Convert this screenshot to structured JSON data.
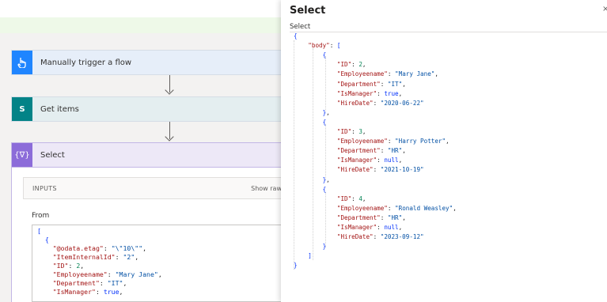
{
  "flow": {
    "steps": [
      {
        "label": "Manually trigger a flow",
        "icon": "hand-pointer-icon"
      },
      {
        "label": "Get items",
        "icon": "sharepoint-icon",
        "icon_text": "S"
      },
      {
        "label": "Select",
        "icon": "data-operation-icon",
        "icon_text": "{∇}"
      }
    ],
    "inputs_title": "INPUTS",
    "show_raw": "Show raw",
    "from_label": "From",
    "code_lines": [
      "[",
      "  {",
      "    \"@odata.etag\": \"\\\"10\\\"\",",
      "    \"ItemInternalId\": \"2\",",
      "    \"ID\": 2,",
      "    \"Employeename\": \"Mary Jane\",",
      "    \"Department\": \"IT\",",
      "    \"IsManager\": true,"
    ]
  },
  "panel": {
    "title": "Select",
    "subtitle": "Select",
    "json_lines": [
      "{",
      "  \"body\": [",
      "    {",
      "      \"ID\": 2,",
      "      \"Employeename\": \"Mary Jane\",",
      "      \"Department\": \"IT\",",
      "      \"IsManager\": true,",
      "      \"HireDate\": \"2020-06-22\"",
      "    },",
      "    {",
      "      \"ID\": 3,",
      "      \"Employeename\": \"Harry Potter\",",
      "      \"Department\": \"HR\",",
      "      \"IsManager\": null,",
      "      \"HireDate\": \"2021-10-19\"",
      "    },",
      "    {",
      "      \"ID\": 4,",
      "      \"Employeename\": \"Ronald Weasley\",",
      "      \"Department\": \"HR\",",
      "      \"IsManager\": null,",
      "      \"HireDate\": \"2023-09-12\"",
      "    }",
      "  ]",
      "}"
    ]
  },
  "colors": {
    "trigger_accent": "#1f85ff",
    "sharepoint_accent": "#038387",
    "select_accent": "#8c6cd9",
    "json_key": "#a31515",
    "json_string": "#0451a5",
    "json_number": "#098658"
  }
}
